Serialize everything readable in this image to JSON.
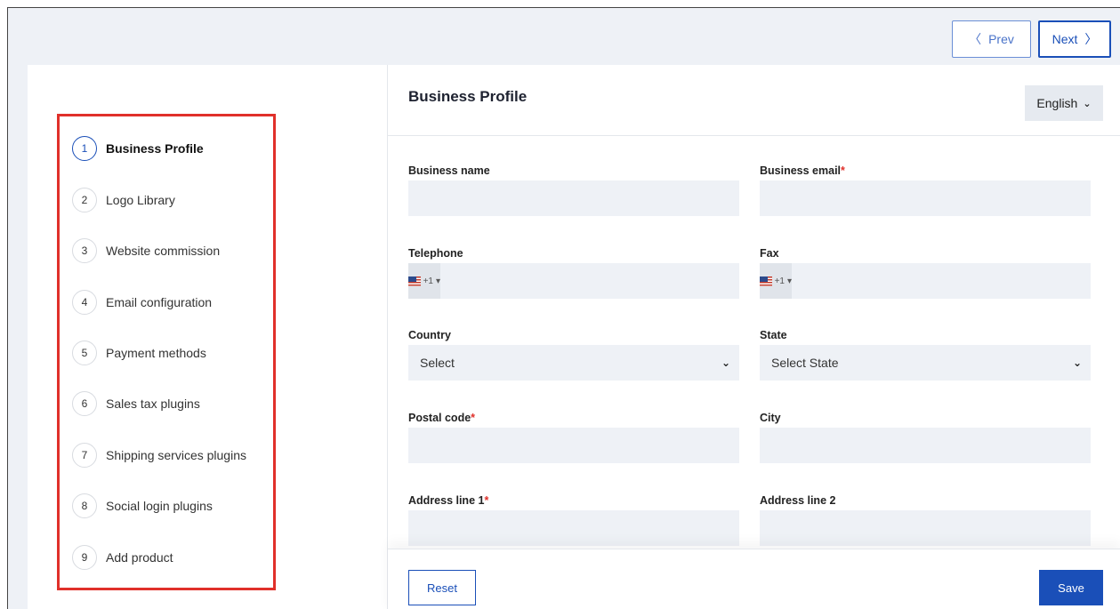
{
  "nav": {
    "prev_label": "Prev",
    "next_label": "Next"
  },
  "steps": [
    {
      "num": "1",
      "label": "Business Profile"
    },
    {
      "num": "2",
      "label": "Logo Library"
    },
    {
      "num": "3",
      "label": "Website commission"
    },
    {
      "num": "4",
      "label": "Email configuration"
    },
    {
      "num": "5",
      "label": "Payment methods"
    },
    {
      "num": "6",
      "label": "Sales tax plugins"
    },
    {
      "num": "7",
      "label": "Shipping services plugins"
    },
    {
      "num": "8",
      "label": "Social login plugins"
    },
    {
      "num": "9",
      "label": "Add product"
    }
  ],
  "form": {
    "title": "Business Profile",
    "language": "English",
    "business_name_label": "Business name",
    "business_email_label": "Business email",
    "telephone_label": "Telephone",
    "fax_label": "Fax",
    "dial_code": "+1",
    "country_label": "Country",
    "country_value": "Select",
    "state_label": "State",
    "state_value": "Select State",
    "postal_code_label": "Postal code",
    "city_label": "City",
    "address1_label": "Address line 1",
    "address2_label": "Address line 2",
    "required_mark": "*"
  },
  "footer": {
    "reset_label": "Reset",
    "save_label": "Save"
  },
  "colors": {
    "accent": "#1a4fb8",
    "highlight": "#e0302a",
    "field_bg": "#eef1f6"
  }
}
